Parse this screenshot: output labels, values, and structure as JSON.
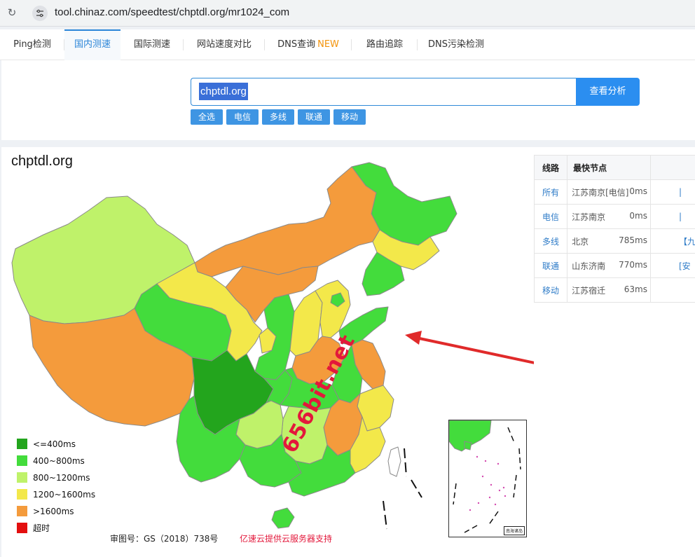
{
  "browser": {
    "url": "tool.chinaz.com/speedtest/chptdl.org/mr1024_com"
  },
  "tabs": [
    {
      "label": "Ping检测",
      "badge": "",
      "active": false
    },
    {
      "label": "国内测速",
      "badge": "",
      "active": true
    },
    {
      "label": "国际测速",
      "badge": "",
      "active": false
    },
    {
      "label": "网站速度对比",
      "badge": "",
      "active": false
    },
    {
      "label": "DNS查询",
      "badge": "NEW",
      "active": false
    },
    {
      "label": "路由追踪",
      "badge": "",
      "active": false
    },
    {
      "label": "DNS污染检测",
      "badge": "",
      "active": false
    }
  ],
  "search": {
    "value": "chptdl.org",
    "button_label": "查看分析",
    "filters": [
      "全选",
      "电信",
      "多线",
      "联通",
      "移动"
    ]
  },
  "result": {
    "domain": "chptdl.org",
    "legend": [
      {
        "label": "<=400ms",
        "color": "#23a51d"
      },
      {
        "label": "400~800ms",
        "color": "#43dc3c"
      },
      {
        "label": "800~1200ms",
        "color": "#bff26a"
      },
      {
        "label": "1200~1600ms",
        "color": "#f3e84a"
      },
      {
        "label": ">1600ms",
        "color": "#f49b3c"
      },
      {
        "label": "超时",
        "color": "#e30f0f"
      }
    ],
    "map_number": "审图号：GS（2018）738号",
    "sponsor": "亿速云提供云服务器支持",
    "inset_label": "南海诸岛",
    "watermark": "656bit.net"
  },
  "route_table": {
    "headers": [
      "线路",
      "最快节点"
    ],
    "rows": [
      {
        "line": "所有",
        "node": "江苏南京[电信]",
        "ms": "0ms",
        "extra": "|"
      },
      {
        "line": "电信",
        "node": "江苏南京",
        "ms": "0ms",
        "extra": "|"
      },
      {
        "line": "多线",
        "node": "北京",
        "ms": "785ms",
        "extra": "【九"
      },
      {
        "line": "联通",
        "node": "山东济南",
        "ms": "770ms",
        "extra": "[安"
      },
      {
        "line": "移动",
        "node": "江苏宿迁",
        "ms": "63ms",
        "extra": ""
      }
    ]
  },
  "colors": {
    "accent": "#2b8ef0",
    "arrow": "#e02a2a"
  }
}
